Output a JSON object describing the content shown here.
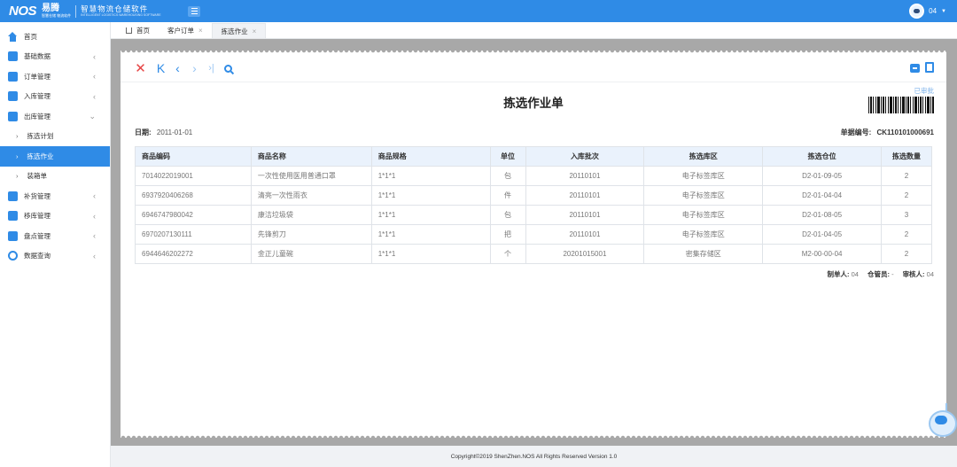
{
  "header": {
    "logo": "NOS",
    "brand": "易腾",
    "brand_sub": "智慧仓储 物流软件",
    "app_name": "智慧物流仓储软件",
    "app_name_en": "INTELLIGENT LOGISTICS WAREHOUSING SOFTWARE",
    "user": "04",
    "user_caret": "▼",
    "accent_color": "#2f8be6"
  },
  "sidebar": {
    "items": [
      {
        "label": "首页",
        "icon": "home-icon"
      },
      {
        "label": "基础数据",
        "icon": "chart-icon",
        "arrow": "‹"
      },
      {
        "label": "订单管理",
        "icon": "list-icon",
        "arrow": "‹"
      },
      {
        "label": "入库管理",
        "icon": "inbound-icon",
        "arrow": "‹"
      },
      {
        "label": "出库管理",
        "icon": "outbound-icon",
        "arrow": "⌄"
      },
      {
        "label": "拣选计划",
        "chev": "›"
      },
      {
        "label": "拣选作业",
        "chev": "›"
      },
      {
        "label": "装箱单",
        "chev": "›"
      },
      {
        "label": "补货管理",
        "icon": "replenish-icon",
        "arrow": "‹"
      },
      {
        "label": "移库管理",
        "icon": "transfer-icon",
        "arrow": "‹"
      },
      {
        "label": "盘点管理",
        "icon": "inventory-icon",
        "arrow": "‹"
      },
      {
        "label": "数据查询",
        "icon": "search-icon",
        "arrow": "‹"
      }
    ]
  },
  "tabs": [
    {
      "label": "首页"
    },
    {
      "label": "客户订单",
      "close": "×"
    },
    {
      "label": "拣选作业",
      "close": "×"
    }
  ],
  "toolbar": {
    "close": "✕",
    "first": "K",
    "prev": "‹",
    "next": "›",
    "last": "›|"
  },
  "document": {
    "title": "拣选作业单",
    "status": "已审批",
    "date_label": "日期:",
    "date_value": "2011-01-01",
    "docno_label": "单据编号:",
    "docno_value": "CK110101000691",
    "columns": [
      "商品编码",
      "商品名称",
      "商品规格",
      "单位",
      "入库批次",
      "拣选库区",
      "拣选仓位",
      "拣选数量"
    ],
    "rows": [
      [
        "7014022019001",
        "一次性使用医用普通口罩",
        "1*1*1",
        "包",
        "20110101",
        "电子标签库区",
        "D2-01-09-05",
        "2"
      ],
      [
        "6937920406268",
        "清亮一次性雨衣",
        "1*1*1",
        "件",
        "20110101",
        "电子标签库区",
        "D2-01-04-04",
        "2"
      ],
      [
        "6946747980042",
        "康洁垃圾袋",
        "1*1*1",
        "包",
        "20110101",
        "电子标签库区",
        "D2-01-08-05",
        "3"
      ],
      [
        "6970207130111",
        "先锋剪刀",
        "1*1*1",
        "把",
        "20110101",
        "电子标签库区",
        "D2-01-04-05",
        "2"
      ],
      [
        "6944646202272",
        "金正儿童碗",
        "1*1*1",
        "个",
        "20201015001",
        "密集存储区",
        "M2-00-00-04",
        "2"
      ]
    ],
    "maker_label": "制单人:",
    "maker_value": "04",
    "keeper_label": "仓管员:",
    "keeper_value": "-",
    "reviewer_label": "审核人:",
    "reviewer_value": "04"
  },
  "footer": {
    "copyright": "Copyright©2019 ShenZhen.NOS All Rights Reserved Version 1.0"
  }
}
